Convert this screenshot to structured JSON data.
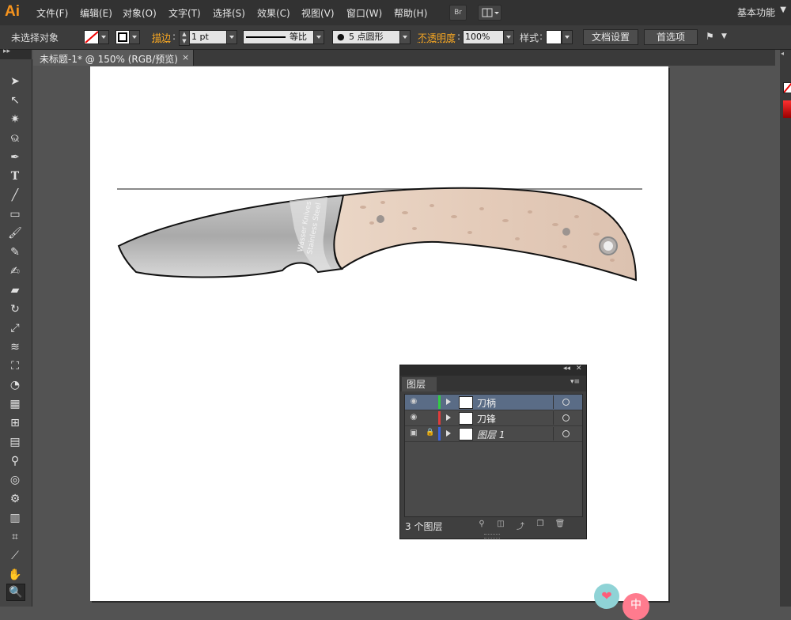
{
  "app": {
    "logo": "Ai",
    "workspace": "基本功能"
  },
  "menu": [
    "文件(F)",
    "编辑(E)",
    "对象(O)",
    "文字(T)",
    "选择(S)",
    "效果(C)",
    "视图(V)",
    "窗口(W)",
    "帮助(H)"
  ],
  "menubar_buttons": {
    "bridge": "Br"
  },
  "control": {
    "selection": "未选择对象",
    "stroke_label": "描边",
    "stroke_weight": "1 pt",
    "stroke_profile": "等比",
    "brush": "5 点圆形",
    "opacity_label": "不透明度",
    "opacity": "100%",
    "style_label": "样式",
    "doc_setup": "文档设置",
    "prefs": "首选项"
  },
  "document_tab": {
    "title": "未标题-1* @ 150% (RGB/预览)",
    "close": "×"
  },
  "artwork": {
    "blade_text_line1": "Wasser Knives",
    "blade_text_line2": "Stainless Steel"
  },
  "layers_panel": {
    "tab": "图层",
    "collapse": "◂◂",
    "close": "✕",
    "menu": "▾≡",
    "layers": [
      {
        "name": "刀柄",
        "color": "#33cc44",
        "visible": true,
        "locked": false,
        "selected": true
      },
      {
        "name": "刀锋",
        "color": "#e03c3c",
        "visible": true,
        "locked": false,
        "selected": false
      },
      {
        "name": "图层 1",
        "color": "#3c64e0",
        "visible": true,
        "locked": true,
        "selected": false
      }
    ],
    "count": "3 个图层"
  },
  "badges": {
    "heart": "❤",
    "cn": "中"
  }
}
